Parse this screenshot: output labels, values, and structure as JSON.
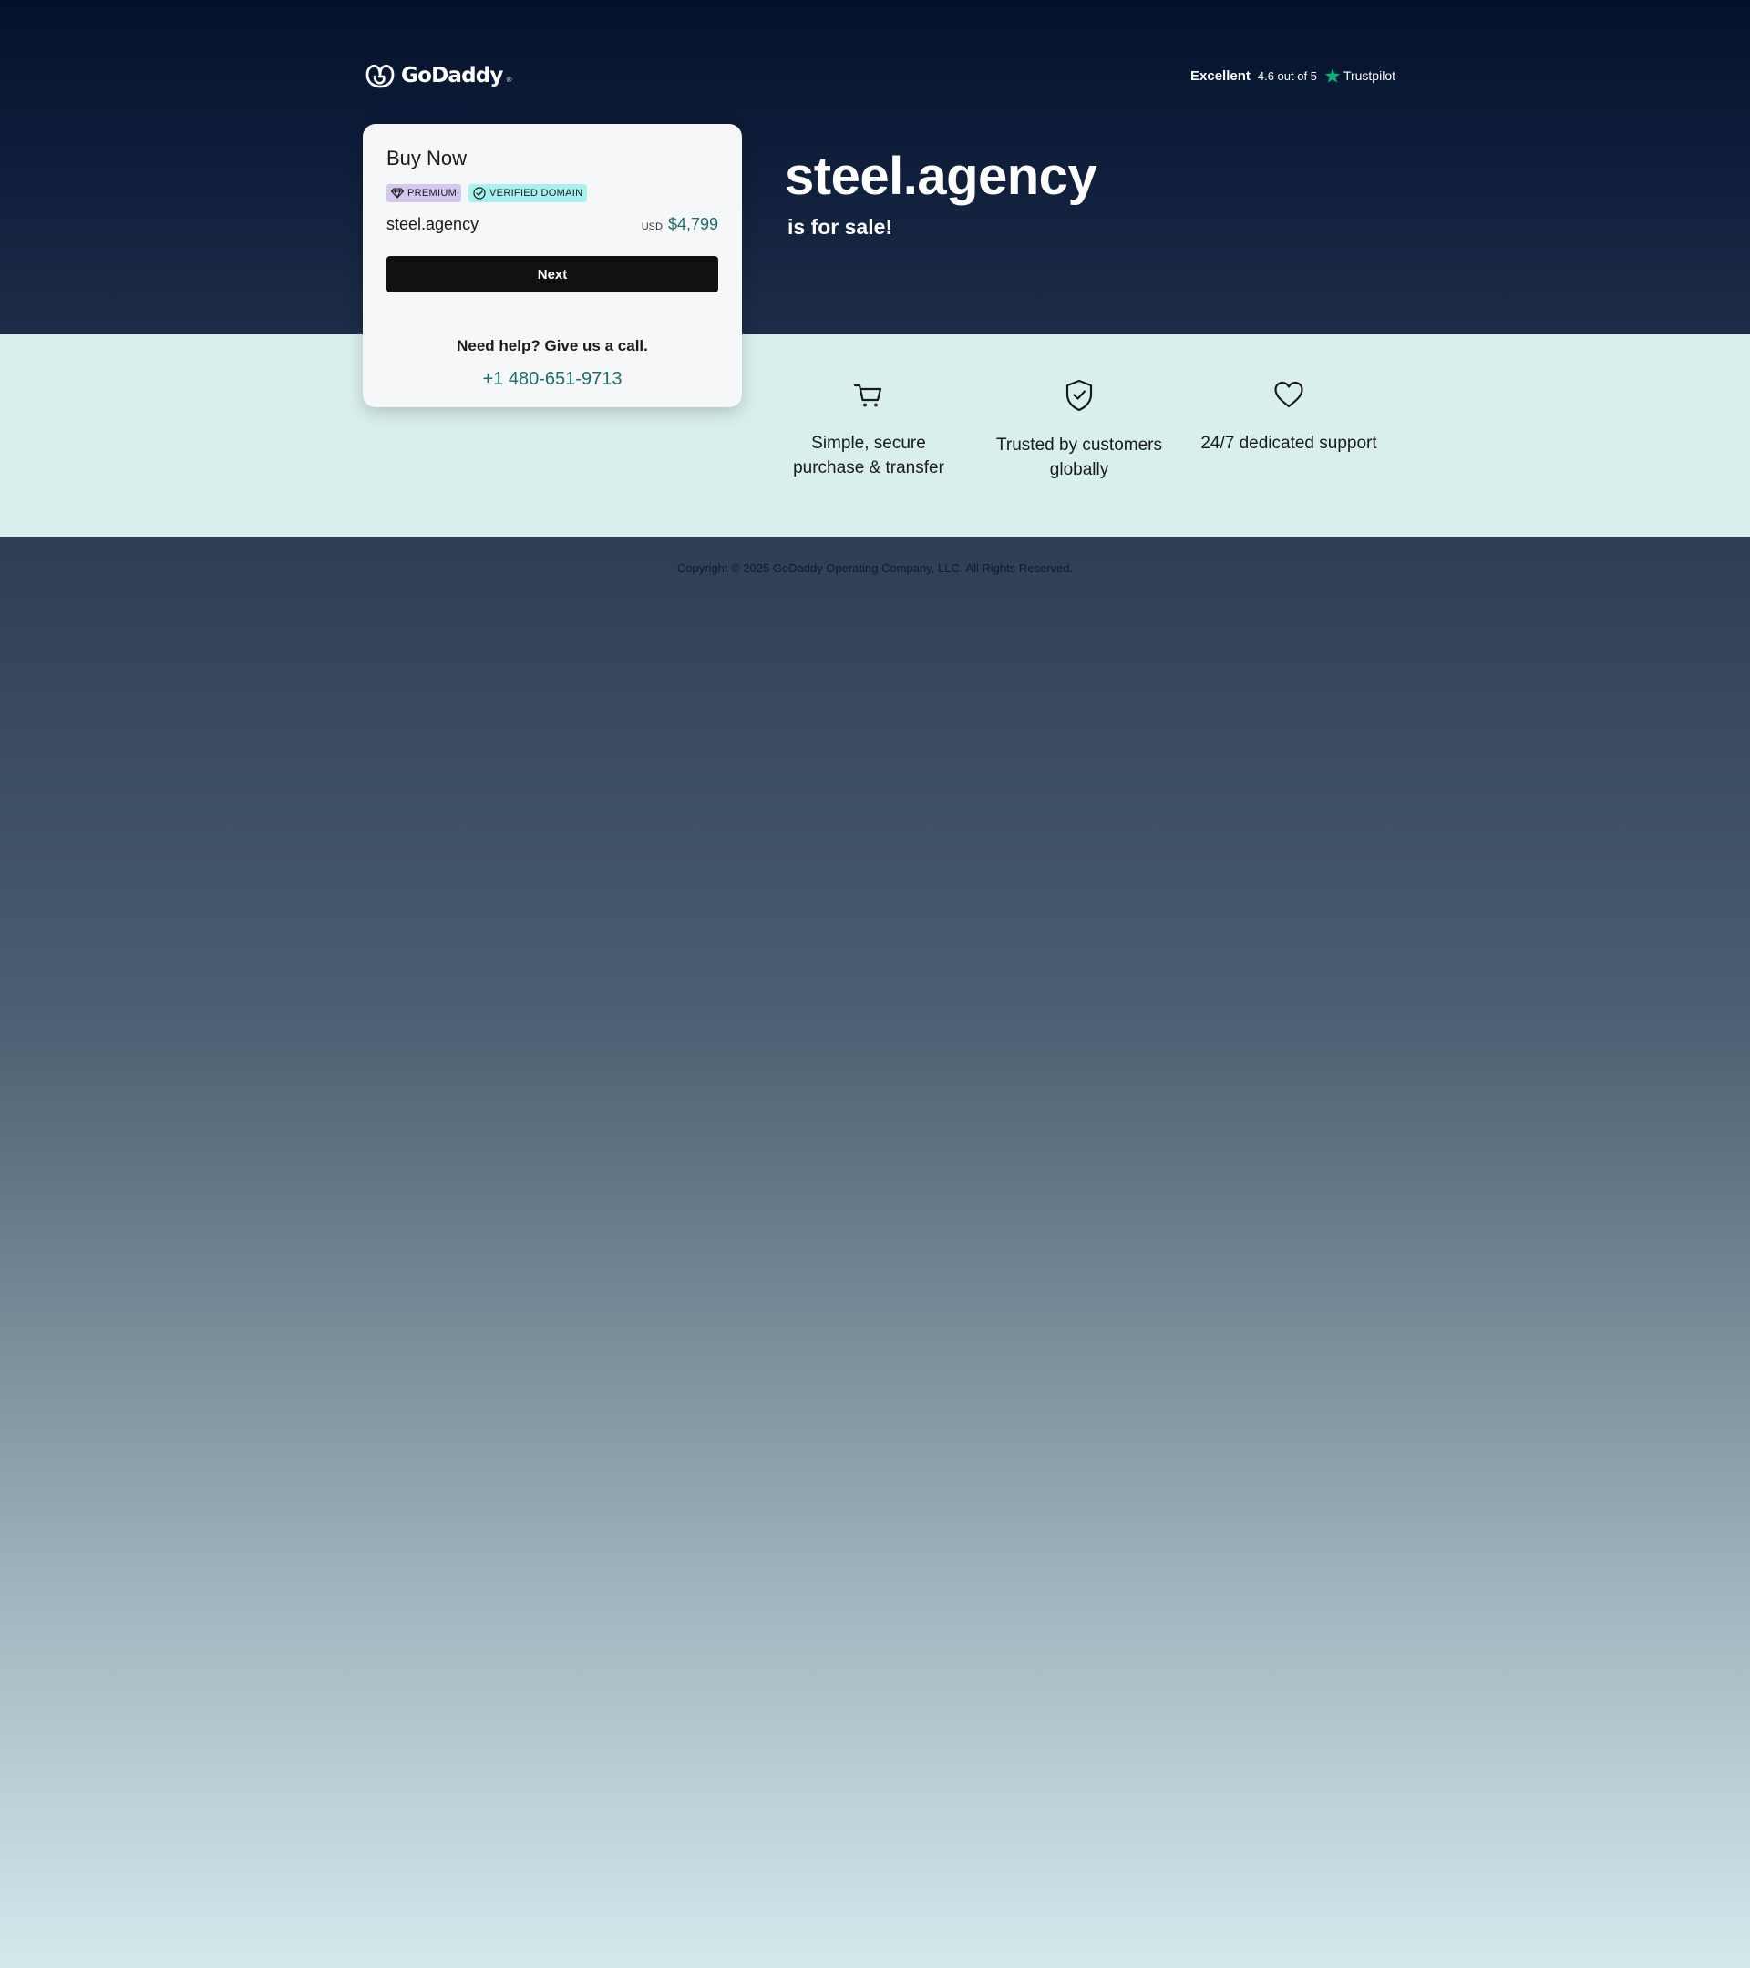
{
  "brand": {
    "name": "GoDaddy",
    "tm": "®"
  },
  "trustpilot": {
    "rating_label": "Excellent",
    "score_text": "4.6 out of 5",
    "brand": "Trustpilot",
    "star_color": "#00b67a"
  },
  "card": {
    "title": "Buy Now",
    "badges": {
      "premium": "PREMIUM",
      "verified": "VERIFIED DOMAIN"
    },
    "domain": "steel.agency",
    "currency": "USD",
    "price": "$4,799",
    "next_label": "Next",
    "help_text": "Need help? Give us a call.",
    "phone": "+1 480-651-9713"
  },
  "hero": {
    "domain": "steel.agency",
    "subtitle": "is for sale!"
  },
  "features": [
    {
      "icon": "cart-icon",
      "label": "Simple, secure purchase & transfer"
    },
    {
      "icon": "shield-check-icon",
      "label": "Trusted by customers globally"
    },
    {
      "icon": "heart-icon",
      "label": "24/7 dedicated support"
    }
  ],
  "footer": {
    "copyright": "Copyright © 2025 GoDaddy Operating Company, LLC. All Rights Reserved."
  },
  "colors": {
    "accent_teal": "#1d6b6b",
    "premium_badge": "#d5c8ef",
    "verified_badge": "#a8f1ef",
    "band": "#d9efec"
  }
}
